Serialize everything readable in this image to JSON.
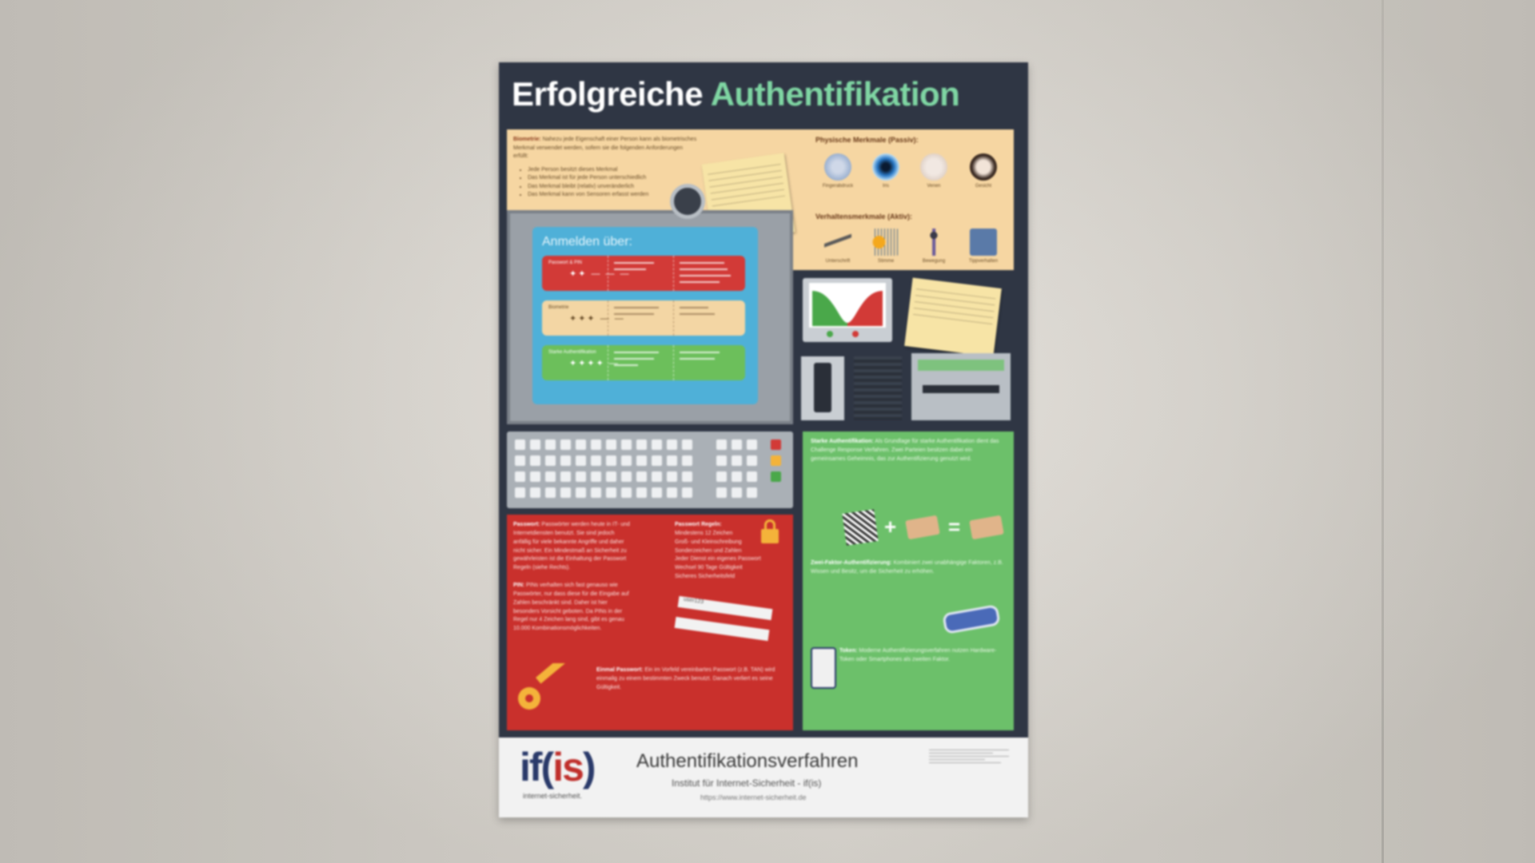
{
  "poster": {
    "title_part1": "Erfolgreiche",
    "title_part2": "Authentifikation",
    "biometrics": {
      "intro_label": "Biometrie:",
      "intro_text": "Nahezu jede Eigenschaft einer Person kann als biometrisches Merkmal verwendet werden, sofern sie die folgenden Anforderungen erfüllt:",
      "requirements": [
        "Jede Person besitzt dieses Merkmal",
        "Das Merkmal ist für jede Person unterschiedlich",
        "Das Merkmal bleibt (relativ) unveränderlich",
        "Das Merkmal kann von Sensoren erfasst werden"
      ],
      "passive_heading": "Physische Merkmale (Passiv):",
      "passive_items": [
        "Fingerabdruck",
        "Iris",
        "Venen",
        "Gesicht"
      ],
      "active_heading": "Verhaltensmerkmale (Aktiv):",
      "active_items": [
        "Unterschrift",
        "Stimme",
        "Bewegung",
        "Tippverhalten"
      ]
    },
    "login_screen": {
      "title": "Anmelden über:",
      "rows": [
        {
          "label": "Passwort & PIN",
          "symbols": "✦✦ — — —",
          "color": "#d23a37"
        },
        {
          "label": "Biometrie",
          "symbols": "✦✦✦ — —",
          "color": "#f3d6a4"
        },
        {
          "label": "Starke Authentifikation",
          "symbols": "✦✦✦✦ —",
          "color": "#6cbf5b"
        }
      ]
    },
    "red_panel": {
      "password_label": "Passwort:",
      "password_text": "Passwörter werden heute in IT- und Internetdiensten benutzt. Sie sind jedoch anfällig für viele bekannte Angriffe und daher nicht sicher. Ein Mindestmaß an Sicherheit zu gewährleisten ist die Einhaltung der Passwort Regeln (siehe Rechts).",
      "pin_label": "PIN:",
      "pin_text": "PINs verhalten sich fast genauso wie Passwörter, nur dass diese für die Eingabe auf Zahlen beschränkt sind. Daher ist hier besonders Vorsicht geboten. Da PINs in der Regel nur 4 Zeichen lang sind, gibt es genau 10.000 Kombinationsmöglichkeiten.",
      "rules_heading": "Passwort Regeln:",
      "rules": [
        "Mindestens 12 Zeichen",
        "Groß- und Kleinschreibung",
        "Sonderzeichen und Zahlen",
        "Jeder Dienst ein eigenes Passwort",
        "Wechsel 90 Tage Gültigkeit",
        "Sicheres Sicherheitsfeld"
      ],
      "strip1": "user123",
      "one_time_label": "Einmal Passwort:",
      "one_time_text": "Ein im Vorfeld vereinbartes Passwort (z.B. TAN) wird einmalig zu einem bestimmten Zweck benutzt. Danach verliert es seine Gültigkeit."
    },
    "green_panel": {
      "strong_label": "Starke Authentifikation:",
      "strong_text": "Als Grundlage für starke Authentifikation dient das Challenge Response Verfahren. Zwei Parteien besitzen dabei ein gemeinsames Geheimnis, das zur Authentifizierung genutzt wird.",
      "two_factor_label": "Zwei-Faktor-Authentifizierung:",
      "two_factor_text": "Kombiniert zwei unabhängige Faktoren, z.B. Wissen und Besitz, um die Sicherheit zu erhöhen.",
      "token_label": "Token:",
      "token_text": "Moderne Authentifizierungsverfahren nutzen Hardware-Token oder Smartphones als zweiten Faktor."
    },
    "footer": {
      "logo_part1": "if(",
      "logo_part2": "is",
      "logo_part3": ")",
      "logo_sub": "internet-sicherheit.",
      "title": "Authentifikationsverfahren",
      "subtitle": "Institut für Internet-Sicherheit - if(is)",
      "url": "https://www.internet-sicherheit.de"
    }
  }
}
